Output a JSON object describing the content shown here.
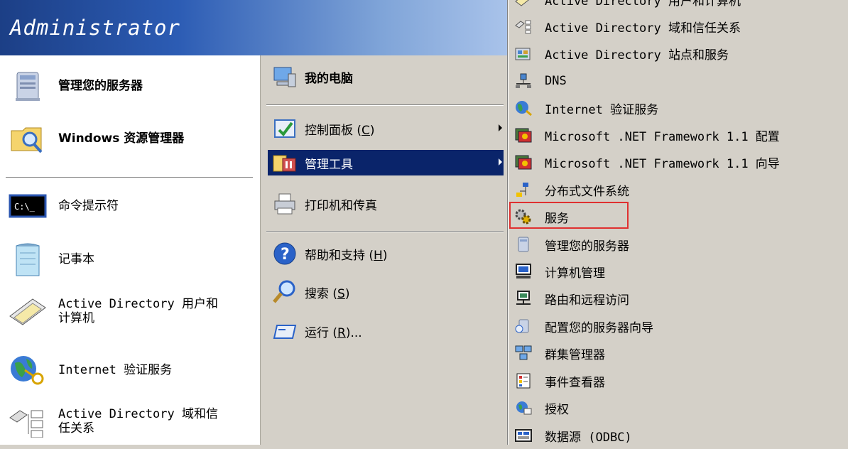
{
  "header": {
    "user": "Administrator"
  },
  "left_panel": {
    "pinned": [
      {
        "label": "管理您的服务器",
        "icon": "server-icon"
      },
      {
        "label": "Windows 资源管理器",
        "icon": "explorer-folder-icon"
      }
    ],
    "recent": [
      {
        "label": "命令提示符",
        "icon": "command-prompt-icon"
      },
      {
        "label": "记事本",
        "icon": "notepad-icon"
      },
      {
        "label": "Active Directory 用户和\n计算机",
        "icon": "ad-users-icon"
      },
      {
        "label": "Internet 验证服务",
        "icon": "globe-key-icon"
      },
      {
        "label": "Active Directory 域和信\n任关系",
        "icon": "ad-trusts-icon"
      }
    ]
  },
  "mid_panel": {
    "items": [
      {
        "label": "我的电脑",
        "icon": "my-computer-icon"
      },
      {
        "label": "控制面板 (",
        "key": "C",
        "suffix": ")",
        "icon": "control-panel-icon"
      },
      {
        "label": "管理工具",
        "icon": "admin-tools-icon"
      },
      {
        "label": "打印机和传真",
        "icon": "printer-icon"
      },
      {
        "label": "帮助和支持 (",
        "key": "H",
        "suffix": ")",
        "icon": "help-icon"
      },
      {
        "label": "搜索 (",
        "key": "S",
        "suffix": ")",
        "icon": "search-icon"
      },
      {
        "label": "运行 (",
        "key": "R",
        "suffix": ")...",
        "icon": "run-icon"
      }
    ]
  },
  "submenu": {
    "items": [
      {
        "label": "Active Directory 用户和计算机",
        "icon": "ad-users-icon"
      },
      {
        "label": "Active Directory 域和信任关系",
        "icon": "ad-trusts-icon"
      },
      {
        "label": "Active Directory 站点和服务",
        "icon": "ad-sites-icon"
      },
      {
        "label": "DNS",
        "icon": "dns-icon"
      },
      {
        "label": "Internet 验证服务",
        "icon": "globe-key-icon"
      },
      {
        "label": "Microsoft .NET Framework 1.1 配置",
        "icon": "dotnet-config-icon"
      },
      {
        "label": "Microsoft .NET Framework 1.1 向导",
        "icon": "dotnet-wizard-icon"
      },
      {
        "label": "分布式文件系统",
        "icon": "dfs-icon"
      },
      {
        "label": "服务",
        "icon": "services-gear-icon"
      },
      {
        "label": "管理您的服务器",
        "icon": "server-icon"
      },
      {
        "label": "计算机管理",
        "icon": "computer-management-icon"
      },
      {
        "label": "路由和远程访问",
        "icon": "routing-icon"
      },
      {
        "label": "配置您的服务器向导",
        "icon": "configure-server-icon"
      },
      {
        "label": "群集管理器",
        "icon": "cluster-icon"
      },
      {
        "label": "事件查看器",
        "icon": "event-viewer-icon"
      },
      {
        "label": "授权",
        "icon": "licensing-icon"
      },
      {
        "label": "数据源 (ODBC)",
        "icon": "odbc-icon"
      }
    ]
  },
  "colors": {
    "selected": "#0a246a",
    "highlight": "#e03030",
    "header": "#2c5cb4"
  }
}
